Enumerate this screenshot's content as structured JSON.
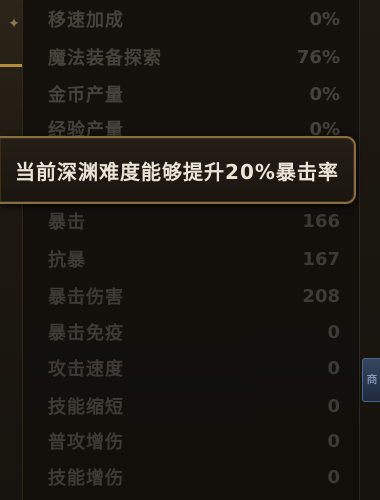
{
  "tooltip": {
    "text": "当前深渊难度能够提升20%暴击率"
  },
  "stats_top": [
    {
      "label": "移速加成",
      "value": "0%"
    },
    {
      "label": "魔法装备探索",
      "value": "76%"
    },
    {
      "label": "金币产量",
      "value": "0%"
    },
    {
      "label": "经验产量",
      "value": "0%"
    }
  ],
  "stats_bottom": [
    {
      "label": "暴击",
      "value": "166"
    },
    {
      "label": "抗暴",
      "value": "167"
    },
    {
      "label": "暴击伤害",
      "value": "208"
    },
    {
      "label": "暴击免疫",
      "value": "0"
    },
    {
      "label": "攻击速度",
      "value": "0"
    },
    {
      "label": "技能缩短",
      "value": "0"
    },
    {
      "label": "普攻增伤",
      "value": "0"
    },
    {
      "label": "技能增伤",
      "value": "0"
    }
  ],
  "side_tab": {
    "label": "商"
  },
  "icons": {
    "corner": "emblem-icon"
  },
  "colors": {
    "tooltip_border": "#8a6d3e",
    "tooltip_text": "#ece4d6",
    "dim_text": "#3c3a35",
    "accent_gold": "#b48a3c"
  }
}
